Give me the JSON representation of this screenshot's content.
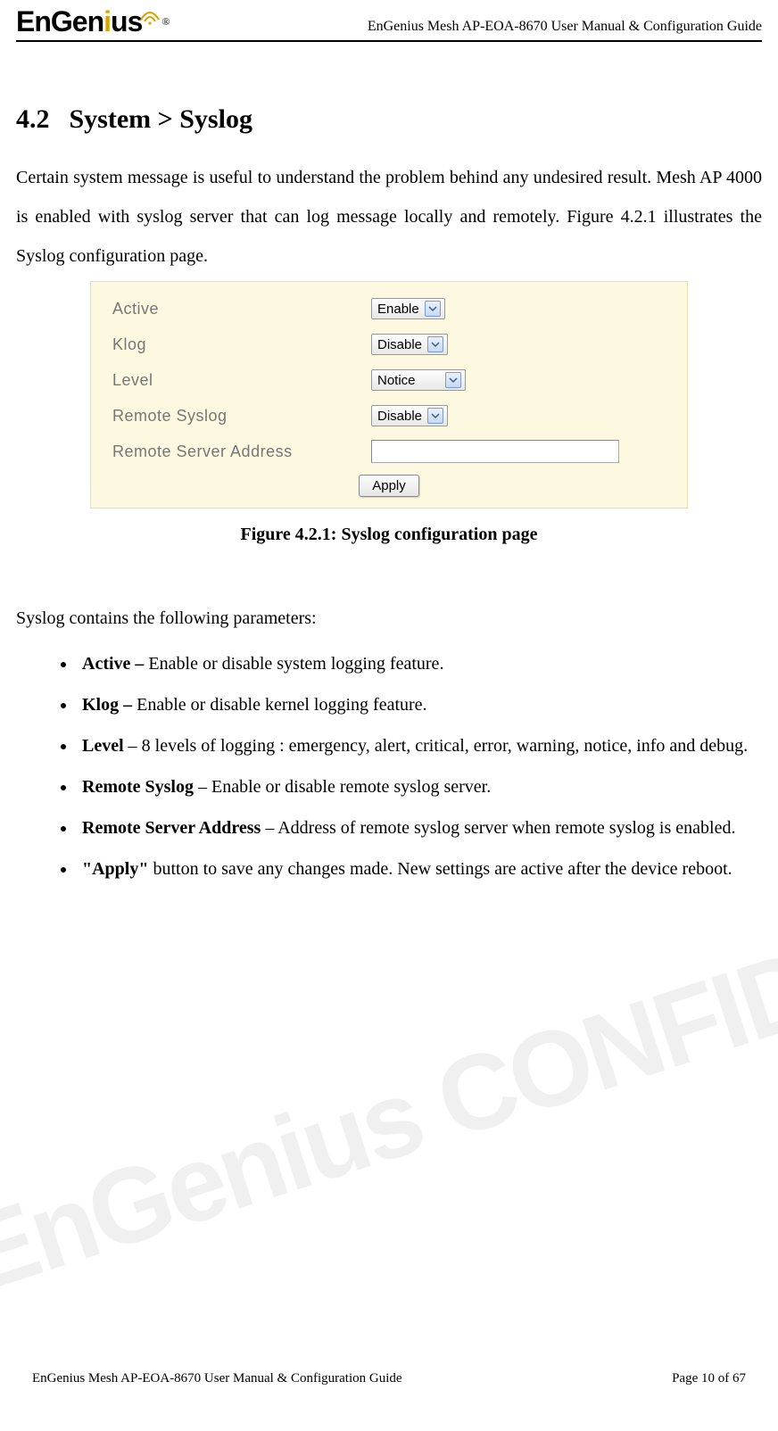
{
  "header": {
    "logo_brand": "EnGenius",
    "doc_title": "EnGenius Mesh AP-EOA-8670 User Manual & Configuration Guide"
  },
  "section": {
    "number": "4.2",
    "title": "System > Syslog"
  },
  "intro": "Certain system message is useful to understand the problem behind any undesired result. Mesh AP 4000 is enabled with syslog server that can log message locally and remotely. Figure 4.2.1 illustrates the Syslog configuration page.",
  "figure": {
    "rows": {
      "active": {
        "label": "Active",
        "value": "Enable"
      },
      "klog": {
        "label": "Klog",
        "value": "Disable"
      },
      "level": {
        "label": "Level",
        "value": "Notice"
      },
      "remote_syslog": {
        "label": "Remote Syslog",
        "value": "Disable"
      },
      "remote_addr": {
        "label": "Remote Server Address",
        "value": ""
      }
    },
    "apply_label": "Apply",
    "caption": "Figure 4.2.1: Syslog configuration page"
  },
  "params_intro": "Syslog contains the following parameters:",
  "params": {
    "active": {
      "term": "Active – ",
      "desc": "Enable or disable system logging feature."
    },
    "klog": {
      "term": "Klog – ",
      "desc": "Enable or disable kernel logging feature."
    },
    "level": {
      "term": "Level",
      "desc": " – 8 levels of logging : emergency, alert, critical, error, warning, notice, info and debug."
    },
    "remote_syslog": {
      "term": "Remote Syslog",
      "desc": " – Enable or disable remote syslog server."
    },
    "remote_addr": {
      "term": "Remote Server Address",
      "desc": " – Address of remote syslog server when remote syslog is enabled."
    },
    "apply": {
      "term": "\"Apply\"",
      "desc": " button to save any changes made. New settings are active after the device reboot."
    }
  },
  "footer": {
    "left": "EnGenius Mesh AP-EOA-8670 User Manual & Configuration Guide",
    "right": "Page 10 of 67"
  },
  "watermark": "EnGenius CONFIDENTIAL"
}
